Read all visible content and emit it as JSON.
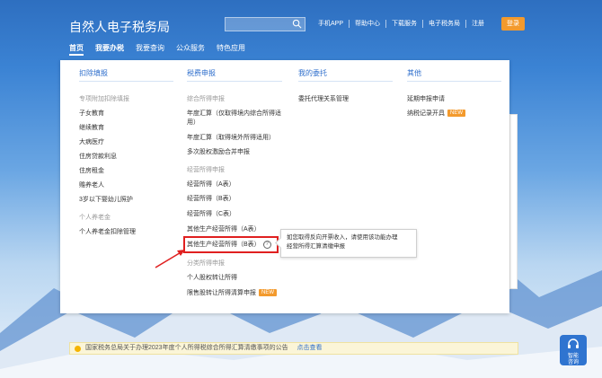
{
  "header": {
    "site_title": "自然人电子税务局",
    "top_links": [
      "手机APP",
      "帮助中心",
      "下载服务",
      "电子税务局",
      "注册"
    ],
    "login_label": "登录"
  },
  "nav": {
    "items": [
      "首页",
      "我要办税",
      "我要查询",
      "公众服务",
      "特色应用"
    ]
  },
  "menu": {
    "col1": {
      "title": "扣除填报",
      "group1": "专项附加扣除填报",
      "items": [
        "子女教育",
        "继续教育",
        "大病医疗",
        "住房贷款利息",
        "住房租金",
        "赡养老人",
        "3岁以下婴幼儿照护"
      ],
      "group2": "个人养老金",
      "items2": [
        "个人养老金扣除管理"
      ]
    },
    "col2": {
      "title": "税费申报",
      "group1": "综合所得申报",
      "items1": [
        "年度汇算（仅取得境内综合所得适",
        "用）",
        "年度汇算（取得境外所得适用）",
        "多次股权激励合并申报"
      ],
      "group2": "经营所得申报",
      "items2": [
        "经营所得（A表）",
        "经营所得（B表）",
        "经营所得（C表）",
        "其他生产经营所得（A表）",
        "其他生产经营所得（B表）"
      ],
      "group3": "分类所得申报",
      "items3": [
        "个人股权转让所得",
        "限售股转让所得清算申报"
      ],
      "new_badge": "NEW"
    },
    "col3": {
      "title": "我的委托",
      "items": [
        "委托代理关系管理"
      ]
    },
    "col4": {
      "title": "其他",
      "items": [
        "延期申报申请",
        "纳税记录开具"
      ],
      "new_badge": "NEW"
    }
  },
  "tooltip": {
    "line1": "如您取得反向开票收入，请使用该功能办理",
    "line2": "经营所得汇算清缴申报"
  },
  "notice": {
    "text": "国家税务总局关于办理2023年度个人所得税综合所得汇算清缴事项的公告",
    "link": "点击查看"
  },
  "service": {
    "line1": "智能",
    "line2": "咨询"
  },
  "colors": {
    "accent": "#2f6fcc",
    "highlight": "#e02020",
    "badge": "#f39a2d"
  }
}
